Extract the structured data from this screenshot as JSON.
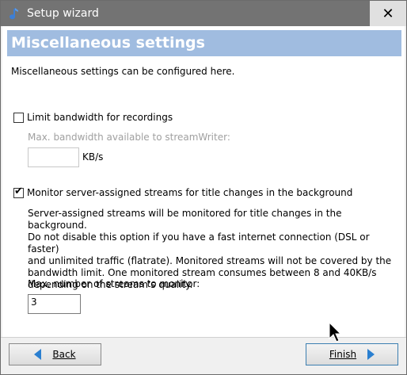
{
  "window": {
    "title": "Setup wizard",
    "close_glyph": "✕"
  },
  "header": {
    "title": "Miscellaneous settings"
  },
  "intro": "Miscellaneous settings can be configured here.",
  "bandwidth": {
    "checkbox_label": "Limit bandwidth for recordings",
    "checked": false,
    "field_label": "Max. bandwidth available to streamWriter:",
    "value": "",
    "unit": "KB/s"
  },
  "monitor": {
    "checkbox_label": "Monitor server-assigned streams for title changes in the background",
    "checked": true,
    "check_glyph": "✔",
    "description": [
      "Server-assigned streams will be monitored for title changes in the background.",
      "Do not disable this option if you have a fast internet connection (DSL or faster)",
      "and unlimited traffic (flatrate). Monitored streams will not be covered by the",
      "bandwidth limit. One monitored stream consumes between 8 and 40KB/s",
      "depending on the stream's quality."
    ],
    "count_label": "Max. number of streams to monitor:",
    "count_value": "3"
  },
  "buttons": {
    "back": "Back",
    "finish": "Finish"
  },
  "colors": {
    "titlebar": "#737373",
    "header_band": "#a0bce0",
    "arrow": "#2a7fd0"
  },
  "icons": {
    "app": "music-note-icon",
    "close": "close-icon",
    "back": "arrow-left-icon",
    "finish": "arrow-right-icon",
    "cursor": "mouse-pointer-icon"
  }
}
